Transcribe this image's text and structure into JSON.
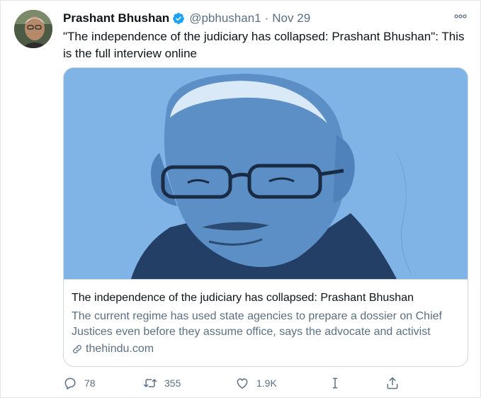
{
  "tweet": {
    "author_name": "Prashant Bhushan",
    "handle": "@pbhushan1",
    "separator": "·",
    "date": "Nov 29",
    "text": "\"The independence of the judiciary has collapsed: Prashant Bhushan\": This is the full interview online"
  },
  "card": {
    "title": "The independence of the judiciary has collapsed: Prashant Bhushan",
    "description": "The current regime has used state agencies to prepare a dossier on Chief Justices even before they assume office, says the advocate and activist",
    "domain": "thehindu.com"
  },
  "actions": {
    "replies": "78",
    "retweets": "355",
    "likes": "1.9K"
  },
  "icons": {
    "verified": "verified-badge-icon",
    "more": "more-options-icon",
    "link": "link-icon",
    "reply": "reply-icon",
    "retweet": "retweet-icon",
    "like": "heart-icon",
    "analytics": "analytics-icon",
    "share": "share-icon"
  },
  "colors": {
    "accent": "#1da1f2",
    "secondary_text": "#5b7083",
    "card_image_bg": "#7fb3e4"
  }
}
